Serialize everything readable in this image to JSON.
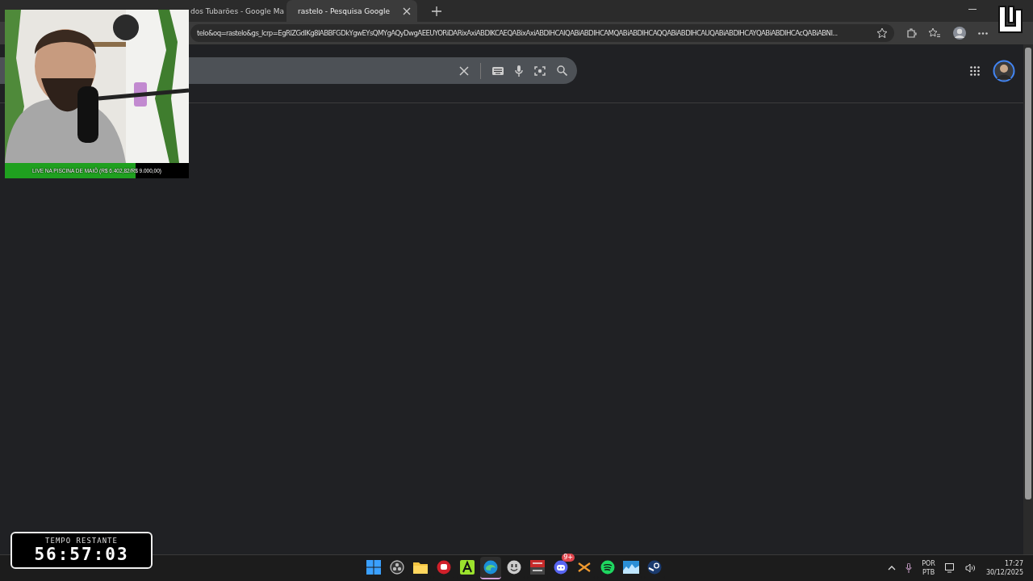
{
  "tabs": [
    {
      "title": "dos Tubarões - Google Ma",
      "selected": false
    },
    {
      "title": "rastelo - Pesquisa Google",
      "selected": true
    }
  ],
  "address_bar": {
    "url": "telo&oq=rastelo&gs_lcrp=EgRlZGdlKg8IABBFGDkYgwEYsQMYgAQyDwgAEEUYORiDARixAxiABDIKCAEQABixAxiABDIHCAIQABiABDIHCAMQABiABDIHCAQQABiABDIHCAUQABiABDIHCAYQABiABDIHCAcQABiABNI..."
  },
  "webcam": {
    "kind": "picture",
    "goal_label": "LIVE NA PISCINA DE MAIÔ (R$ 6.402,82/R$ 9.000,00)",
    "level": 0.71
  },
  "timer": {
    "label": "TEMPO RESTANTE",
    "time": "56:57:03"
  },
  "taskbar": {
    "apps": [
      {
        "kind": "start",
        "selected": false
      },
      {
        "kind": "obs",
        "selected": false
      },
      {
        "kind": "folder",
        "selected": false
      },
      {
        "kind": "red",
        "selected": false
      },
      {
        "kind": "greena",
        "selected": false
      },
      {
        "kind": "edge",
        "selected": true
      },
      {
        "kind": "smiley",
        "selected": false
      },
      {
        "kind": "voicemeter",
        "selected": false
      },
      {
        "kind": "discord",
        "selected": false,
        "badge": "9+"
      },
      {
        "kind": "cross",
        "selected": false
      },
      {
        "kind": "spotify",
        "selected": false
      },
      {
        "kind": "graph",
        "selected": false
      },
      {
        "kind": "steam",
        "selected": false
      }
    ],
    "language": [
      "POR",
      "PTB"
    ],
    "time": "17:27",
    "date": "30/12/2025"
  }
}
